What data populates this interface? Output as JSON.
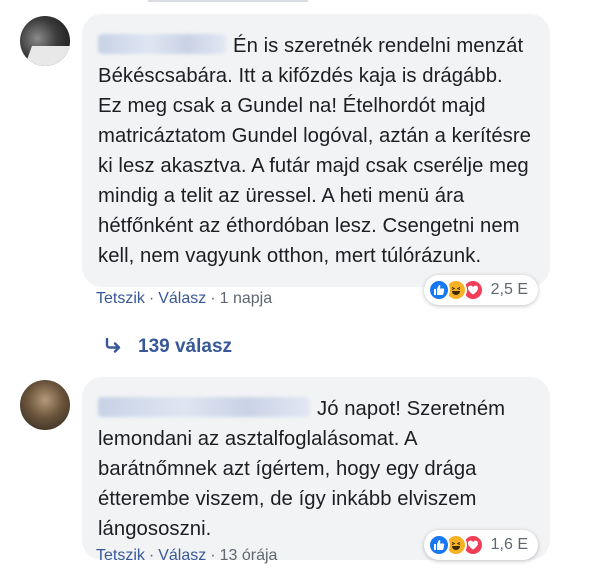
{
  "comments": [
    {
      "text": "Én is szeretnék rendelni menzát Békéscsabára. Itt a kifőzdés kaja is drágább. Ez meg csak a Gundel na! Ételhordót majd matricáztatom Gundel logóval, aztán a kerítésre ki lesz akasztva. A futár majd csak cserélje meg mindig a telit az üressel. A heti menü ára hétfőnként az éthordóban lesz. Csengetni nem kell, nem vagyunk otthon, mert túlórázunk.",
      "like_label": "Tetszik",
      "reply_label": "Válasz",
      "time": "1 napja",
      "reaction_count": "2,5 E",
      "reaction_icons": [
        "like-icon",
        "haha-icon",
        "love-icon"
      ]
    },
    {
      "text": "Jó napot! Szeretném lemondani az asztalfoglalásomat. A barátnőmnek azt ígértem, hogy egy drága étterembe viszem, de így inkább elviszem lángososzni.",
      "like_label": "Tetszik",
      "reply_label": "Válasz",
      "time": "13 órája",
      "reaction_count": "1,6 E",
      "reaction_icons": [
        "like-icon",
        "haha-icon",
        "love-icon"
      ]
    }
  ],
  "replies_link": "139 válasz",
  "colors": {
    "link": "#385898",
    "bubble": "#f2f3f5",
    "like": "#1877f2",
    "haha": "#f7b125",
    "love": "#f33e58"
  }
}
